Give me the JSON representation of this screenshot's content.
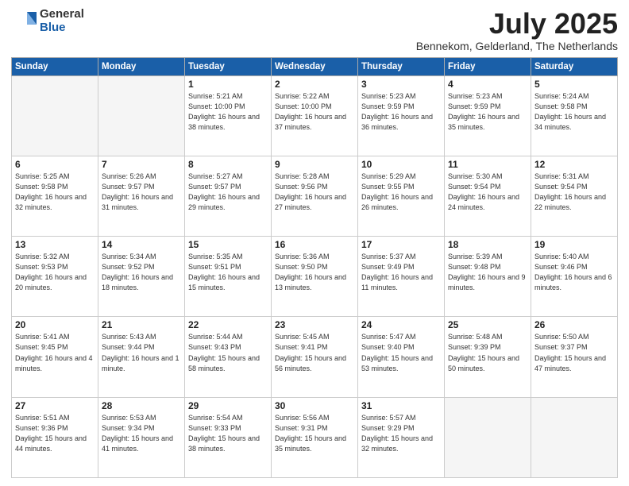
{
  "logo": {
    "general": "General",
    "blue": "Blue"
  },
  "title": "July 2025",
  "subtitle": "Bennekom, Gelderland, The Netherlands",
  "days_of_week": [
    "Sunday",
    "Monday",
    "Tuesday",
    "Wednesday",
    "Thursday",
    "Friday",
    "Saturday"
  ],
  "weeks": [
    [
      {
        "day": "",
        "info": ""
      },
      {
        "day": "",
        "info": ""
      },
      {
        "day": "1",
        "info": "Sunrise: 5:21 AM\nSunset: 10:00 PM\nDaylight: 16 hours\nand 38 minutes."
      },
      {
        "day": "2",
        "info": "Sunrise: 5:22 AM\nSunset: 10:00 PM\nDaylight: 16 hours\nand 37 minutes."
      },
      {
        "day": "3",
        "info": "Sunrise: 5:23 AM\nSunset: 9:59 PM\nDaylight: 16 hours\nand 36 minutes."
      },
      {
        "day": "4",
        "info": "Sunrise: 5:23 AM\nSunset: 9:59 PM\nDaylight: 16 hours\nand 35 minutes."
      },
      {
        "day": "5",
        "info": "Sunrise: 5:24 AM\nSunset: 9:58 PM\nDaylight: 16 hours\nand 34 minutes."
      }
    ],
    [
      {
        "day": "6",
        "info": "Sunrise: 5:25 AM\nSunset: 9:58 PM\nDaylight: 16 hours\nand 32 minutes."
      },
      {
        "day": "7",
        "info": "Sunrise: 5:26 AM\nSunset: 9:57 PM\nDaylight: 16 hours\nand 31 minutes."
      },
      {
        "day": "8",
        "info": "Sunrise: 5:27 AM\nSunset: 9:57 PM\nDaylight: 16 hours\nand 29 minutes."
      },
      {
        "day": "9",
        "info": "Sunrise: 5:28 AM\nSunset: 9:56 PM\nDaylight: 16 hours\nand 27 minutes."
      },
      {
        "day": "10",
        "info": "Sunrise: 5:29 AM\nSunset: 9:55 PM\nDaylight: 16 hours\nand 26 minutes."
      },
      {
        "day": "11",
        "info": "Sunrise: 5:30 AM\nSunset: 9:54 PM\nDaylight: 16 hours\nand 24 minutes."
      },
      {
        "day": "12",
        "info": "Sunrise: 5:31 AM\nSunset: 9:54 PM\nDaylight: 16 hours\nand 22 minutes."
      }
    ],
    [
      {
        "day": "13",
        "info": "Sunrise: 5:32 AM\nSunset: 9:53 PM\nDaylight: 16 hours\nand 20 minutes."
      },
      {
        "day": "14",
        "info": "Sunrise: 5:34 AM\nSunset: 9:52 PM\nDaylight: 16 hours\nand 18 minutes."
      },
      {
        "day": "15",
        "info": "Sunrise: 5:35 AM\nSunset: 9:51 PM\nDaylight: 16 hours\nand 15 minutes."
      },
      {
        "day": "16",
        "info": "Sunrise: 5:36 AM\nSunset: 9:50 PM\nDaylight: 16 hours\nand 13 minutes."
      },
      {
        "day": "17",
        "info": "Sunrise: 5:37 AM\nSunset: 9:49 PM\nDaylight: 16 hours\nand 11 minutes."
      },
      {
        "day": "18",
        "info": "Sunrise: 5:39 AM\nSunset: 9:48 PM\nDaylight: 16 hours\nand 9 minutes."
      },
      {
        "day": "19",
        "info": "Sunrise: 5:40 AM\nSunset: 9:46 PM\nDaylight: 16 hours\nand 6 minutes."
      }
    ],
    [
      {
        "day": "20",
        "info": "Sunrise: 5:41 AM\nSunset: 9:45 PM\nDaylight: 16 hours\nand 4 minutes."
      },
      {
        "day": "21",
        "info": "Sunrise: 5:43 AM\nSunset: 9:44 PM\nDaylight: 16 hours\nand 1 minute."
      },
      {
        "day": "22",
        "info": "Sunrise: 5:44 AM\nSunset: 9:43 PM\nDaylight: 15 hours\nand 58 minutes."
      },
      {
        "day": "23",
        "info": "Sunrise: 5:45 AM\nSunset: 9:41 PM\nDaylight: 15 hours\nand 56 minutes."
      },
      {
        "day": "24",
        "info": "Sunrise: 5:47 AM\nSunset: 9:40 PM\nDaylight: 15 hours\nand 53 minutes."
      },
      {
        "day": "25",
        "info": "Sunrise: 5:48 AM\nSunset: 9:39 PM\nDaylight: 15 hours\nand 50 minutes."
      },
      {
        "day": "26",
        "info": "Sunrise: 5:50 AM\nSunset: 9:37 PM\nDaylight: 15 hours\nand 47 minutes."
      }
    ],
    [
      {
        "day": "27",
        "info": "Sunrise: 5:51 AM\nSunset: 9:36 PM\nDaylight: 15 hours\nand 44 minutes."
      },
      {
        "day": "28",
        "info": "Sunrise: 5:53 AM\nSunset: 9:34 PM\nDaylight: 15 hours\nand 41 minutes."
      },
      {
        "day": "29",
        "info": "Sunrise: 5:54 AM\nSunset: 9:33 PM\nDaylight: 15 hours\nand 38 minutes."
      },
      {
        "day": "30",
        "info": "Sunrise: 5:56 AM\nSunset: 9:31 PM\nDaylight: 15 hours\nand 35 minutes."
      },
      {
        "day": "31",
        "info": "Sunrise: 5:57 AM\nSunset: 9:29 PM\nDaylight: 15 hours\nand 32 minutes."
      },
      {
        "day": "",
        "info": ""
      },
      {
        "day": "",
        "info": ""
      }
    ]
  ]
}
